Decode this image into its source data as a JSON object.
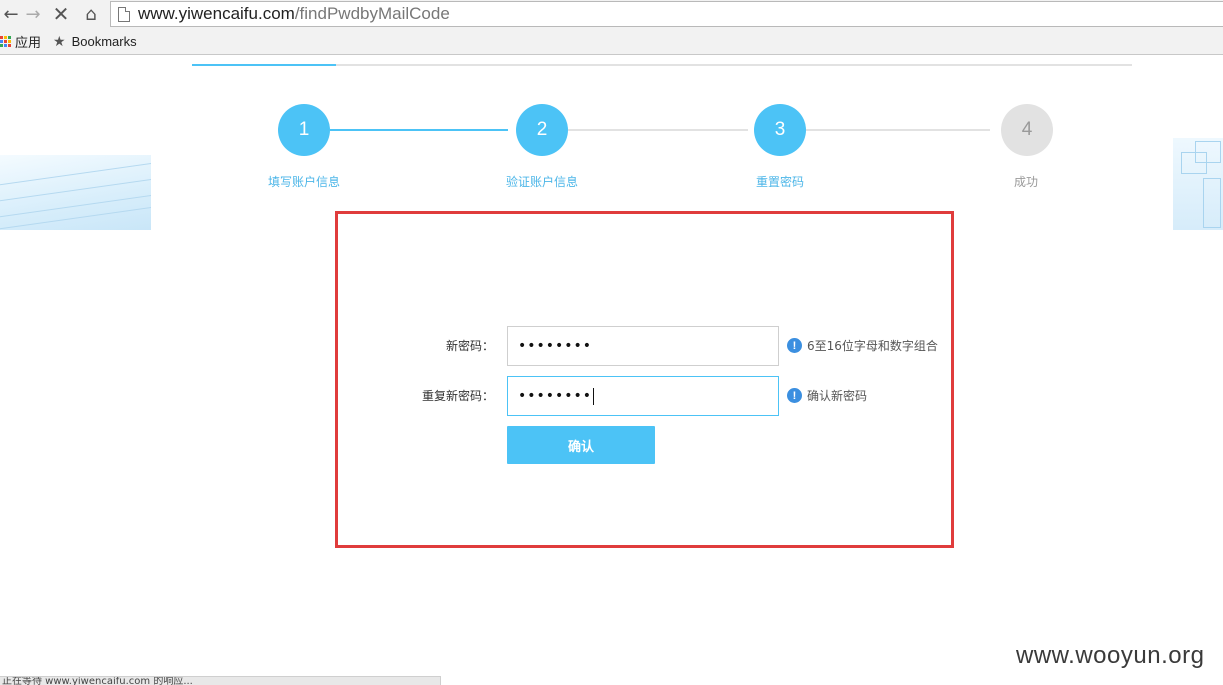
{
  "browser": {
    "url_domain": "www.yiwencaifu.com",
    "url_path": "/findPwdbyMailCode",
    "bookmarks_bar": {
      "apps_label": "应用",
      "bookmarks_label": "Bookmarks"
    },
    "apps_colors": [
      "#e84335",
      "#fbbc05",
      "#34a853",
      "#4285f4",
      "#e84335",
      "#fbbc05",
      "#34a853",
      "#4285f4",
      "#e84335"
    ]
  },
  "steps": [
    {
      "number": "1",
      "label": "填写账户信息",
      "status": "done"
    },
    {
      "number": "2",
      "label": "验证账户信息",
      "status": "done"
    },
    {
      "number": "3",
      "label": "重置密码",
      "status": "done"
    },
    {
      "number": "4",
      "label": "成功",
      "status": "todo"
    }
  ],
  "form": {
    "new_password": {
      "label": "新密码：",
      "value": "••••••••",
      "hint": "6至16位字母和数字组合"
    },
    "repeat_password": {
      "label": "重复新密码：",
      "value": "••••••••",
      "hint": "确认新密码"
    },
    "confirm_label": "确认"
  },
  "statusbar": {
    "text": "正在等待 www.yiwencaifu.com 的响应..."
  },
  "watermark": "www.wooyun.org",
  "colors": {
    "accent": "#4cc3f6",
    "highlight_box": "#e03c3c",
    "inactive": "#e2e2e2",
    "hint_icon": "#3b8fe0"
  }
}
